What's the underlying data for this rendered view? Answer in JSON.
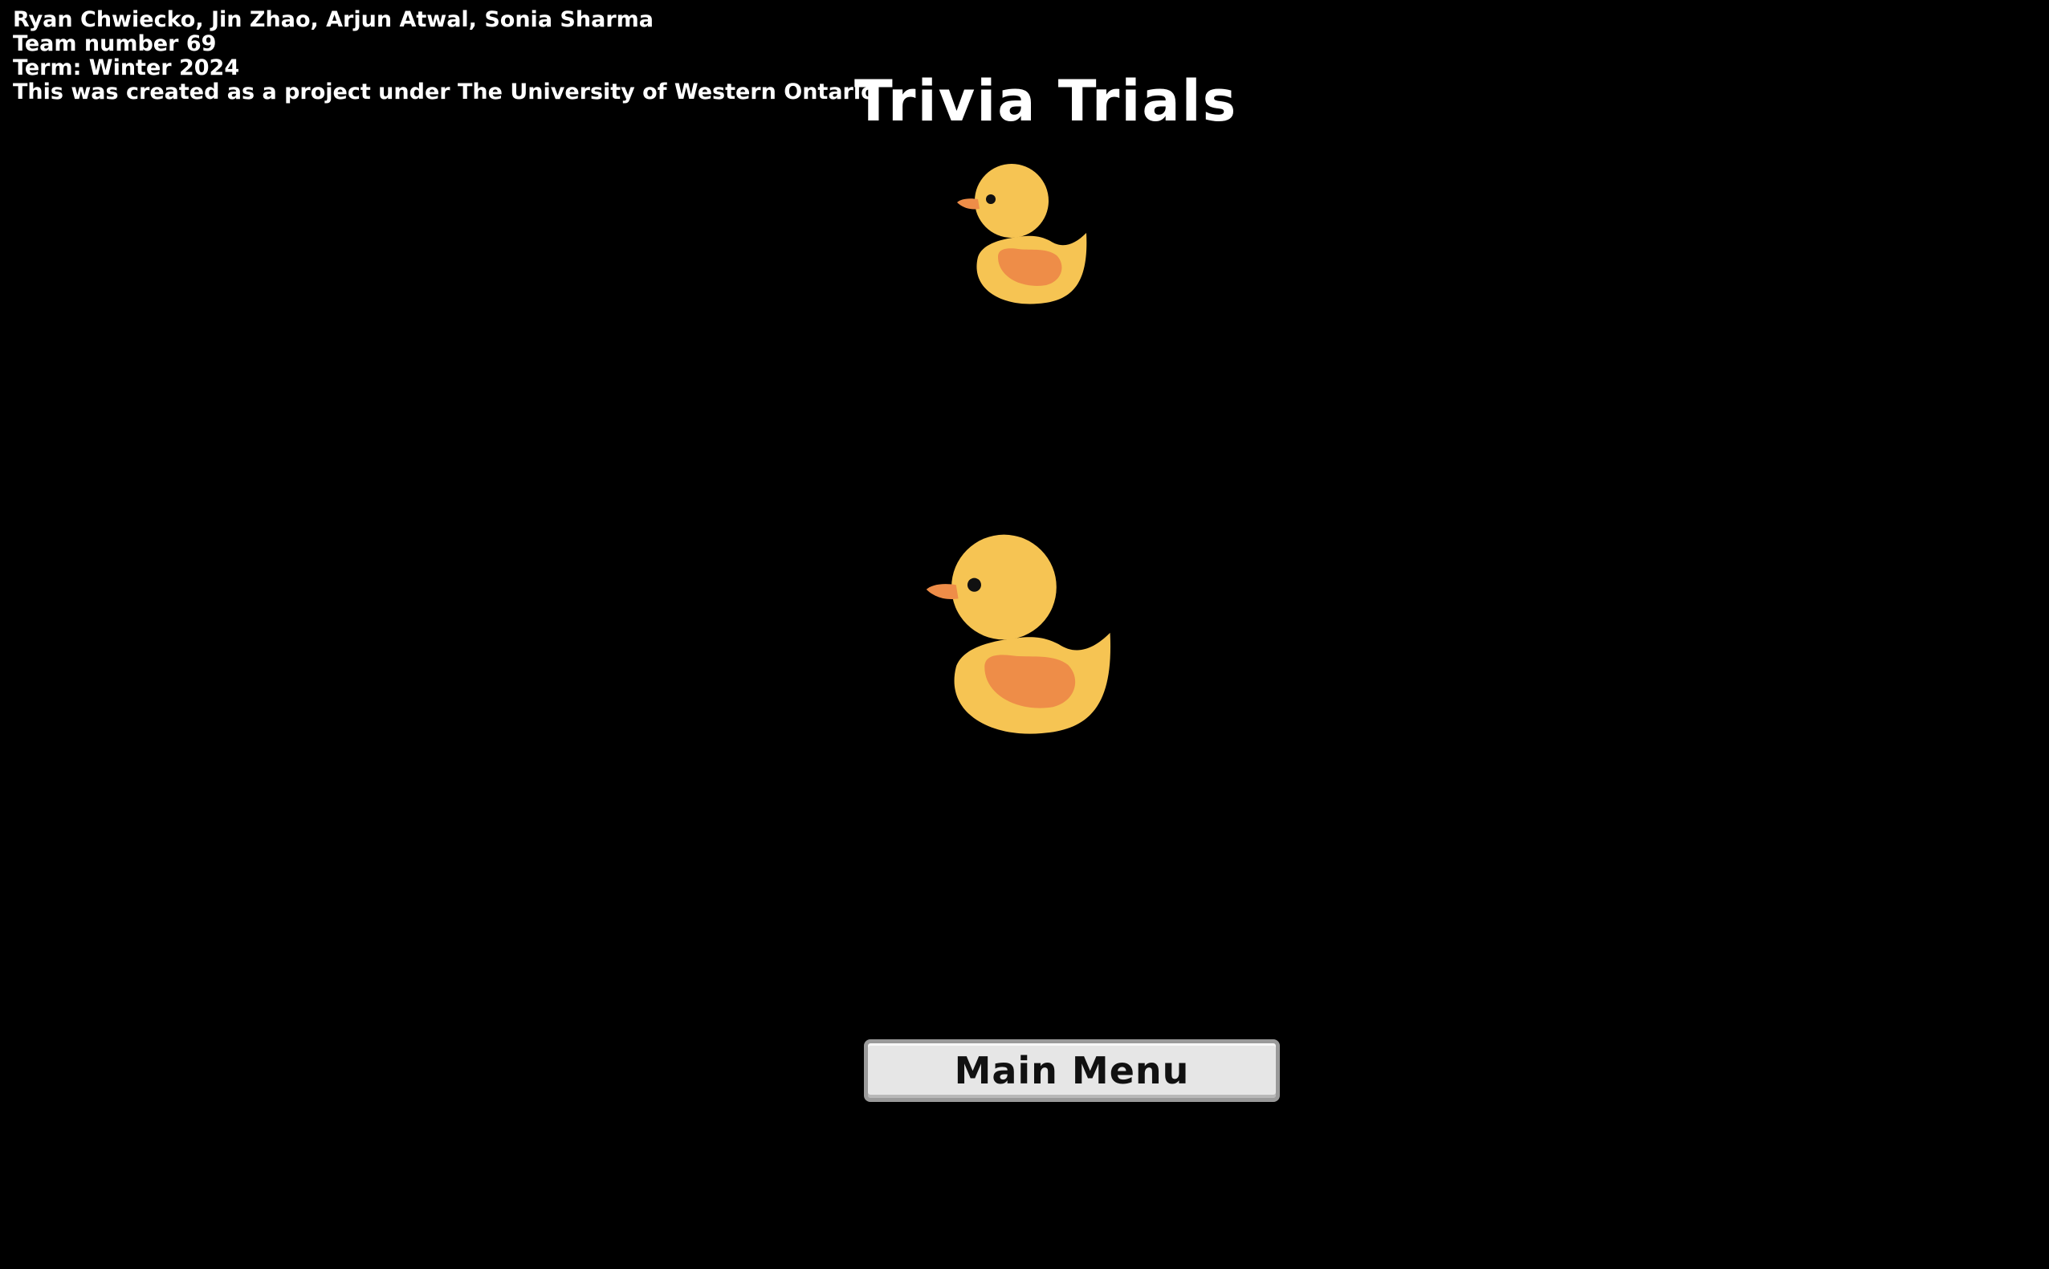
{
  "credits": {
    "authors": "Ryan Chwiecko, Jin Zhao, Arjun Atwal, Sonia Sharma",
    "team": "Team number 69",
    "term": "Term: Winter 2024",
    "institution": "This was created as a project under The University of Western Ontario"
  },
  "title": "Trivia Trials",
  "icons": {
    "top": "duck-icon",
    "center": "duck-icon"
  },
  "buttons": {
    "main_menu": "Main Menu"
  },
  "colors": {
    "background": "#000000",
    "duck_body": "#F6C453",
    "duck_wing": "#EE8D48",
    "duck_beak": "#EE8D48",
    "button_face": "#E6E6E6",
    "button_border": "#9A9A9A",
    "text": "#FFFFFF"
  }
}
